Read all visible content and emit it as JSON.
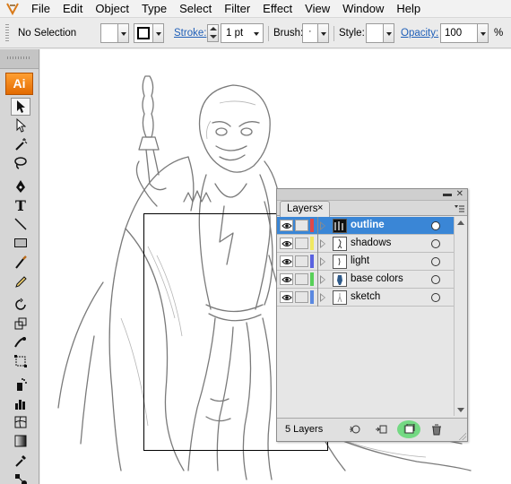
{
  "menubar": {
    "items": [
      {
        "label": "File"
      },
      {
        "label": "Edit"
      },
      {
        "label": "Object"
      },
      {
        "label": "Type"
      },
      {
        "label": "Select"
      },
      {
        "label": "Filter"
      },
      {
        "label": "Effect"
      },
      {
        "label": "View"
      },
      {
        "label": "Window"
      },
      {
        "label": "Help"
      }
    ]
  },
  "controlbar": {
    "selection": "No Selection",
    "stroke_label": "Stroke:",
    "stroke_value": "1 pt",
    "brush_label": "Brush:",
    "brush_value": "·",
    "style_label": "Style:",
    "opacity_label": "Opacity:",
    "opacity_value": "100",
    "percent": "%"
  },
  "tools": {
    "logo": "Ai",
    "items": [
      "selection-tool",
      "direct-selection-tool",
      "magic-wand-tool",
      "lasso-tool",
      "pen-tool",
      "type-tool",
      "line-segment-tool",
      "rectangle-tool",
      "paintbrush-tool",
      "pencil-tool",
      "rotate-tool",
      "scale-tool",
      "warp-tool",
      "free-transform-tool",
      "symbol-sprayer-tool",
      "column-graph-tool",
      "mesh-tool",
      "gradient-tool",
      "eyedropper-tool",
      "blend-tool"
    ]
  },
  "layers_panel": {
    "tab_label": "Layers",
    "tab_close": "×",
    "layers": [
      {
        "name": "outline",
        "color": "#e04848",
        "selected": true
      },
      {
        "name": "shadows",
        "color": "#f0e860",
        "selected": false
      },
      {
        "name": "light",
        "color": "#5a62e0",
        "selected": false
      },
      {
        "name": "base colors",
        "color": "#58d058",
        "selected": false
      },
      {
        "name": "sketch",
        "color": "#5a88e0",
        "selected": false
      }
    ],
    "footer_count": "5 Layers",
    "highlight_color": "#59d76b"
  }
}
